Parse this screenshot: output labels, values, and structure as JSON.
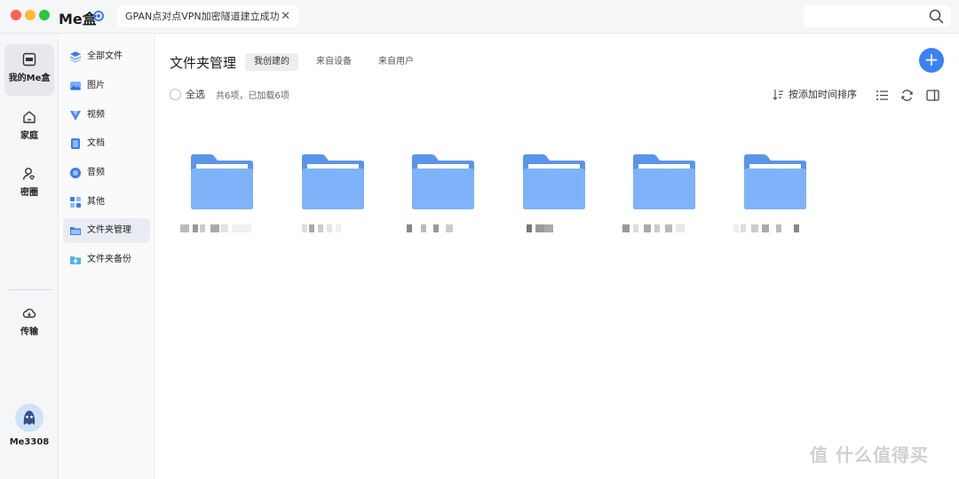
{
  "titlebar": {
    "app_title": "Me盒",
    "vpn_message": "GPAN点对点VPN加密隧道建立成功",
    "vpn_close": "✕"
  },
  "rail": {
    "items": [
      {
        "label": "我的Me盒",
        "icon": "me-box-icon"
      },
      {
        "label": "家庭",
        "icon": "home-icon"
      },
      {
        "label": "密圈",
        "icon": "private-circle-icon"
      },
      {
        "label": "传输",
        "icon": "transfer-icon"
      }
    ],
    "user_name": "Me3308"
  },
  "sidebar": {
    "items": [
      {
        "label": "全部文件",
        "icon": "all-files-icon"
      },
      {
        "label": "图片",
        "icon": "image-icon"
      },
      {
        "label": "视频",
        "icon": "video-icon"
      },
      {
        "label": "文档",
        "icon": "document-icon"
      },
      {
        "label": "音频",
        "icon": "audio-icon"
      },
      {
        "label": "其他",
        "icon": "other-icon"
      },
      {
        "label": "文件夹管理",
        "icon": "folder-manage-icon"
      },
      {
        "label": "文件夹备份",
        "icon": "folder-backup-icon"
      }
    ]
  },
  "main": {
    "title": "文件夹管理",
    "tabs": [
      {
        "label": "我创建的"
      },
      {
        "label": "来自设备"
      },
      {
        "label": "来自用户"
      }
    ],
    "select_all": "全选",
    "count_text": "共6项，已加载6项",
    "sort_label": "按添加时间排序",
    "folders": [
      {
        "name": "(blurred)"
      },
      {
        "name": "(blurred)"
      },
      {
        "name": "(blurred)"
      },
      {
        "name": "(blurred)"
      },
      {
        "name": "(blurred)"
      },
      {
        "name": "(blurred)"
      }
    ]
  },
  "colors": {
    "accent": "#3d82f5",
    "folder_front": "#7eb3f9",
    "folder_back": "#5a95ea"
  },
  "watermark": "值 什么值得买 SMYZ.NET"
}
